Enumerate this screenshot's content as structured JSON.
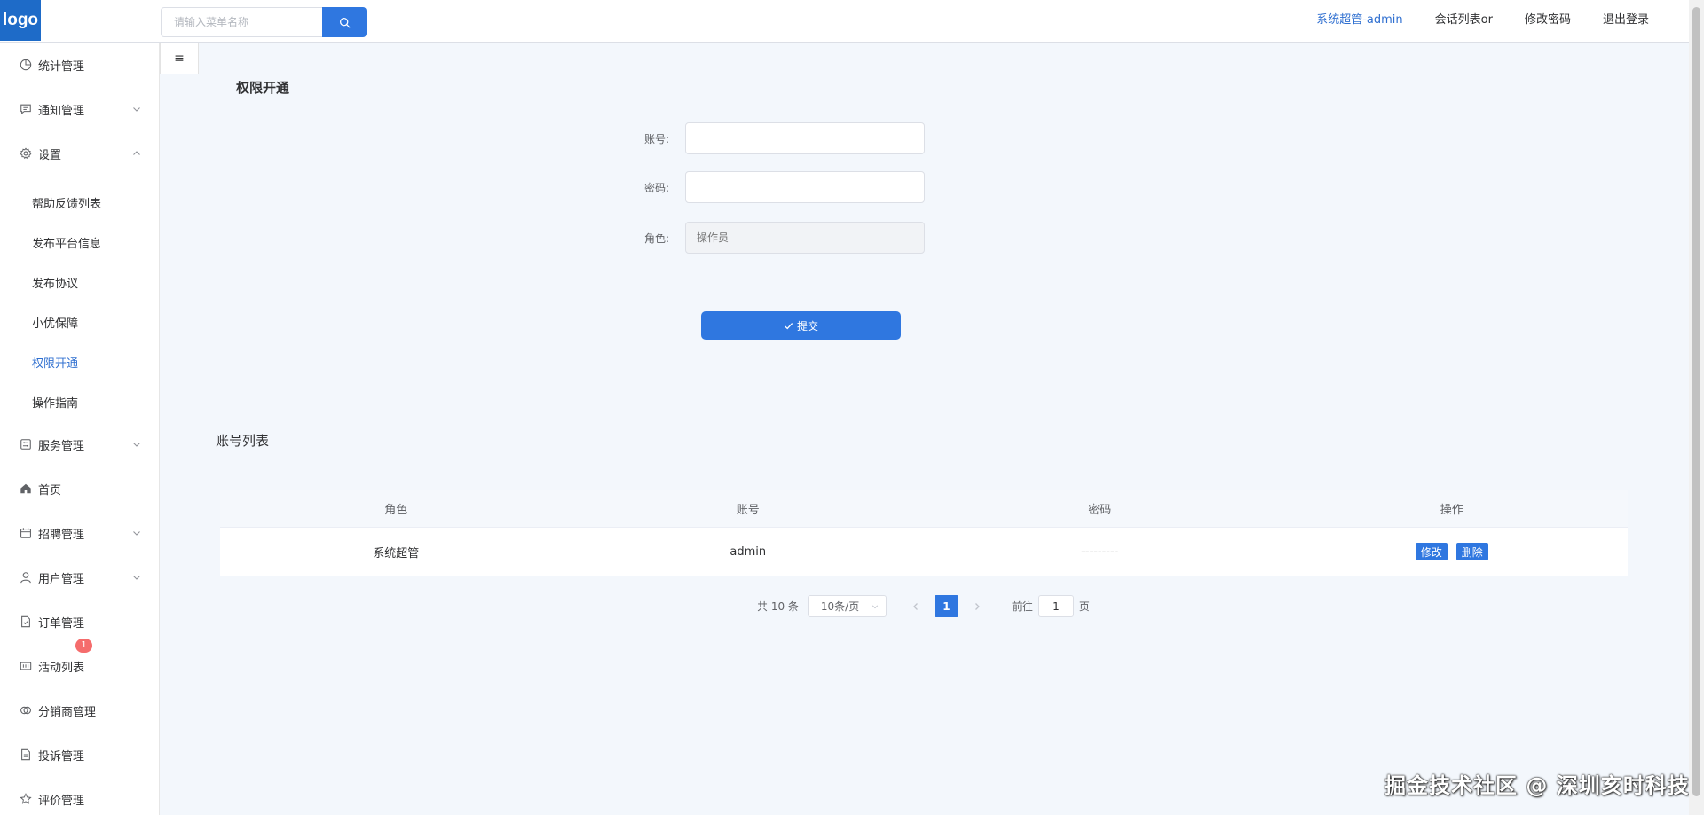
{
  "header": {
    "logo": "logo",
    "search_placeholder": "请输入菜单名称",
    "links": [
      "系统超管-admin",
      "会话列表or",
      "修改密码",
      "退出登录"
    ]
  },
  "sidebar": {
    "items": [
      {
        "label": "统计管理",
        "icon": "pie-chart-icon",
        "has_arrow": false
      },
      {
        "label": "通知管理",
        "icon": "message-icon",
        "has_arrow": true
      },
      {
        "label": "设置",
        "icon": "gear-icon",
        "has_arrow": true,
        "expanded": true
      },
      {
        "label": "服务管理",
        "icon": "service-icon",
        "has_arrow": true
      },
      {
        "label": "首页",
        "icon": "home-icon",
        "has_arrow": false
      },
      {
        "label": "招聘管理",
        "icon": "calendar-icon",
        "has_arrow": true
      },
      {
        "label": "用户管理",
        "icon": "user-icon",
        "has_arrow": true
      },
      {
        "label": "订单管理",
        "icon": "document-icon",
        "has_arrow": false
      },
      {
        "label": "活动列表",
        "icon": "ticket-icon",
        "has_arrow": false,
        "badge": "1"
      },
      {
        "label": "分销商管理",
        "icon": "link-icon",
        "has_arrow": false
      },
      {
        "label": "投诉管理",
        "icon": "document-icon",
        "has_arrow": false
      },
      {
        "label": "评价管理",
        "icon": "star-icon",
        "has_arrow": false
      }
    ],
    "submenu": [
      "帮助反馈列表",
      "发布平台信息",
      "发布协议",
      "小优保障",
      "权限开通",
      "操作指南"
    ],
    "active_submenu": "权限开通"
  },
  "toggle_icon": "≡",
  "page": {
    "title": "权限开通",
    "form": {
      "account_label": "账号:",
      "account_value": "",
      "password_label": "密码:",
      "password_value": "",
      "role_label": "角色:",
      "role_placeholder": "操作员"
    },
    "submit_label": "提交",
    "list_title": "账号列表",
    "table": {
      "headers": [
        "角色",
        "账号",
        "密码",
        "操作"
      ],
      "rows": [
        {
          "role": "系统超管",
          "account": "admin",
          "password": "---------",
          "actions": [
            "修改",
            "删除"
          ]
        }
      ]
    },
    "pagination": {
      "total": "共 10 条",
      "page_size": "10条/页",
      "current": "1",
      "goto_label": "前往",
      "goto_value": "1",
      "page_suffix": "页"
    }
  },
  "watermark": "掘金技术社区 @ 深圳亥时科技",
  "colors": {
    "primary": "#2f77e0",
    "active_text": "#2f6fd0",
    "badge": "#f56c6c",
    "background": "#f3f7fc"
  }
}
